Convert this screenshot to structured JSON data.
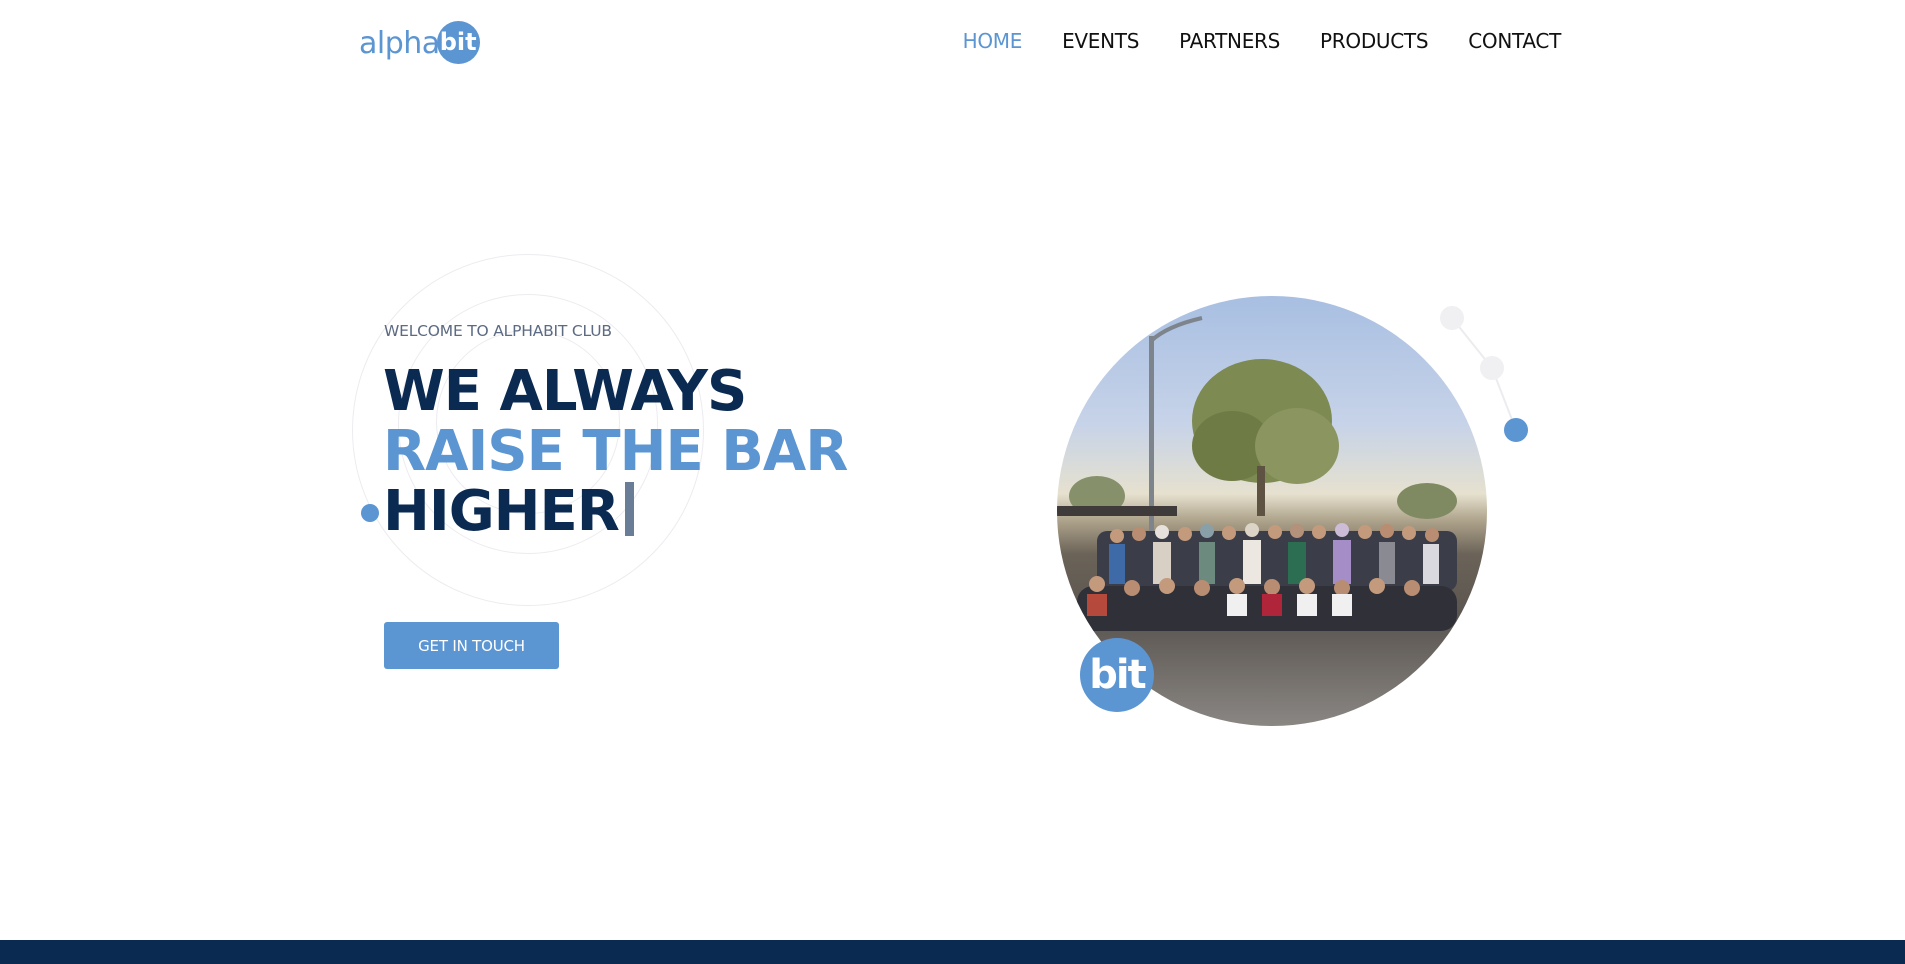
{
  "header": {
    "logo": {
      "alpha": "alpha",
      "bit": "bit"
    },
    "nav": [
      {
        "label": "HOME",
        "active": true
      },
      {
        "label": "EVENTS",
        "active": false
      },
      {
        "label": "PARTNERS",
        "active": false
      },
      {
        "label": "PRODUCTS",
        "active": false
      },
      {
        "label": "CONTACT",
        "active": false
      }
    ]
  },
  "hero": {
    "eyebrow": "WELCOME TO ALPHABIT CLUB",
    "line1": "WE ALWAYS",
    "line2": "RAISE THE BAR",
    "line3": "HIGHER",
    "cta_label": "GET IN TOUCH",
    "badge": "bit"
  },
  "colors": {
    "accent": "#5b95d2",
    "navy": "#0a2a52",
    "muted": "#5c6a82"
  },
  "icons": {
    "photo": "group-photo-image",
    "deco": "connected-dots-icon"
  }
}
